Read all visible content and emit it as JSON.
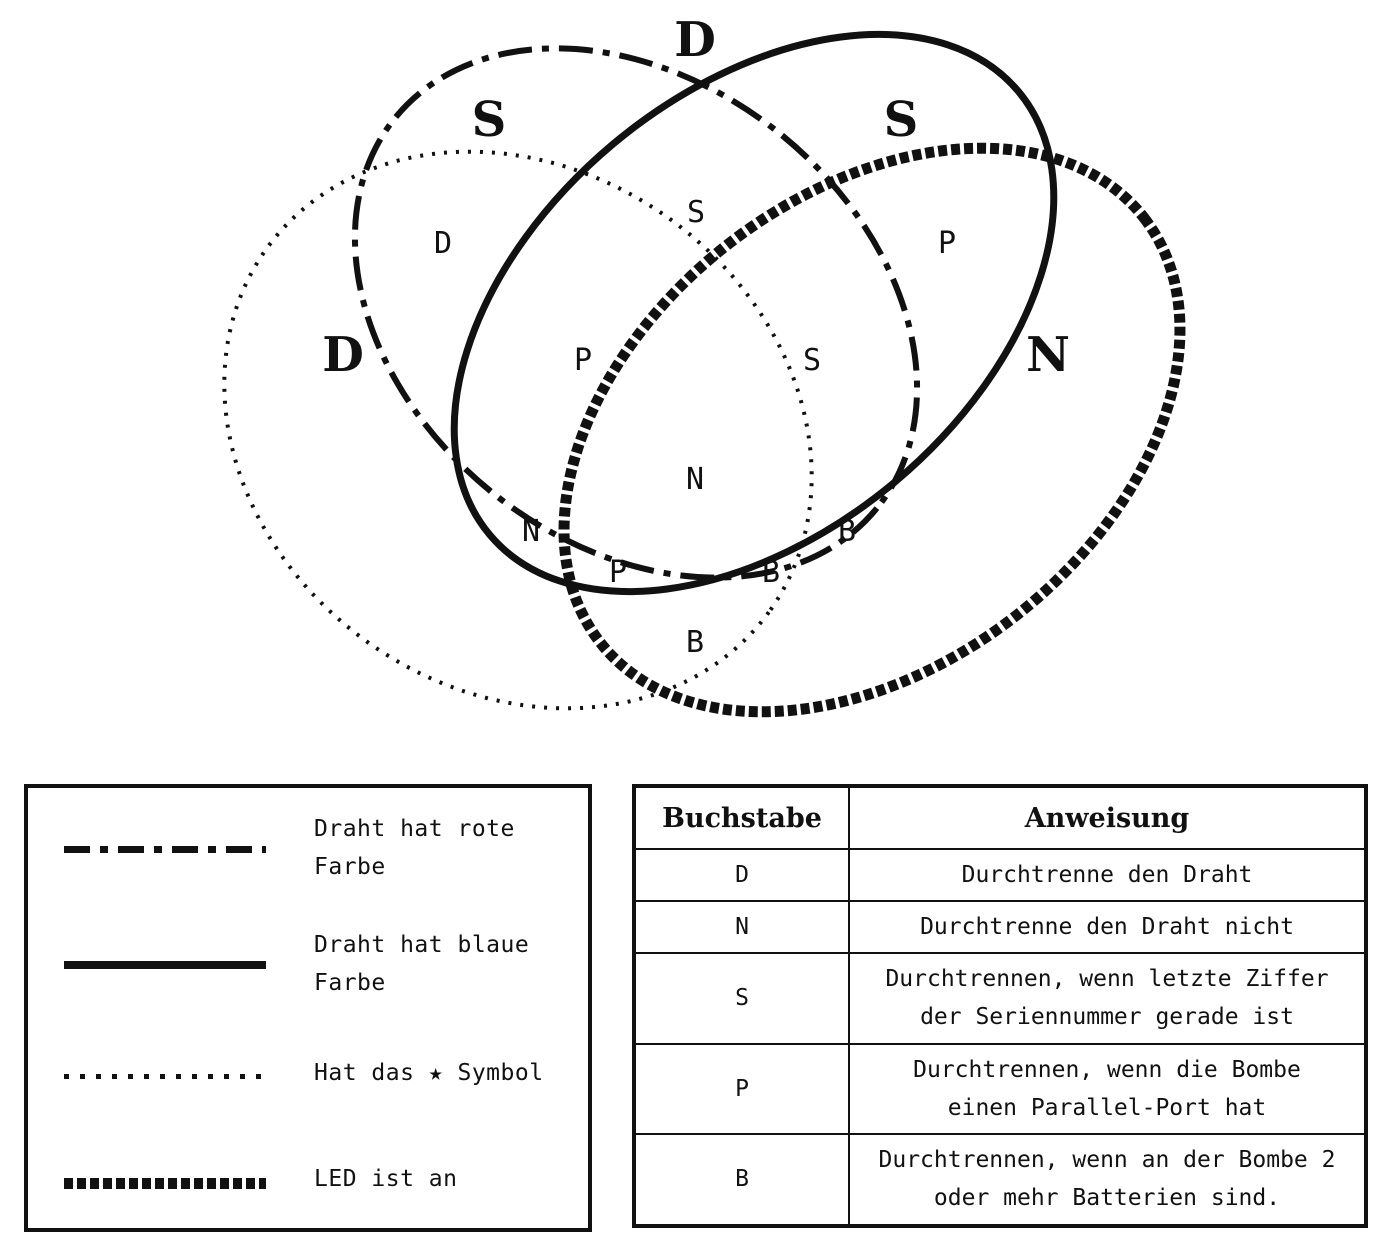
{
  "venn": {
    "corner_labels": [
      "D",
      "S",
      "S",
      "D",
      "N"
    ],
    "region_labels": [
      "S",
      "D",
      "P",
      "P",
      "S",
      "N",
      "N",
      "B",
      "P",
      "B",
      "B"
    ]
  },
  "legend": {
    "items": [
      {
        "style": "dash-dot",
        "text_line1": "Draht hat rote",
        "text_line2": "Farbe"
      },
      {
        "style": "solid",
        "text_line1": "Draht hat blaue",
        "text_line2": "Farbe"
      },
      {
        "style": "dotted",
        "text_line1": "Hat das ★ Symbol",
        "text_line2": ""
      },
      {
        "style": "thick-dashed",
        "text_line1": "LED ist an",
        "text_line2": ""
      }
    ]
  },
  "instructions": {
    "headers": [
      "Buchstabe",
      "Anweisung"
    ],
    "rows": [
      {
        "letter": "D",
        "line1": "Durchtrenne den Draht",
        "line2": ""
      },
      {
        "letter": "N",
        "line1": "Durchtrenne den Draht nicht",
        "line2": ""
      },
      {
        "letter": "S",
        "line1": "Durchtrennen, wenn letzte Ziffer",
        "line2": "der Seriennummer gerade ist"
      },
      {
        "letter": "P",
        "line1": "Durchtrennen, wenn die Bombe",
        "line2": "einen Parallel-Port hat"
      },
      {
        "letter": "B",
        "line1": "Durchtrennen, wenn an der Bombe 2",
        "line2": "oder mehr Batterien sind."
      }
    ]
  }
}
